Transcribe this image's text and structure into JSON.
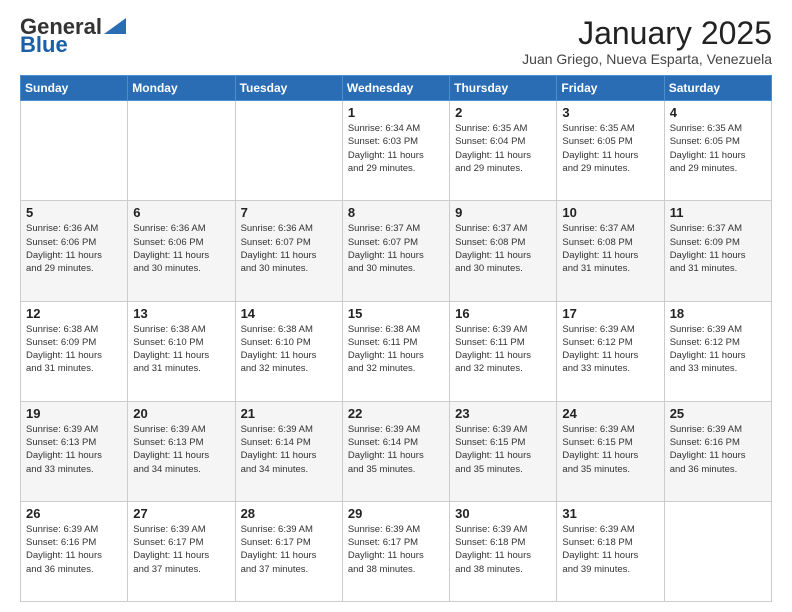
{
  "logo": {
    "general": "General",
    "blue": "Blue"
  },
  "header": {
    "month": "January 2025",
    "location": "Juan Griego, Nueva Esparta, Venezuela"
  },
  "weekdays": [
    "Sunday",
    "Monday",
    "Tuesday",
    "Wednesday",
    "Thursday",
    "Friday",
    "Saturday"
  ],
  "weeks": [
    [
      {
        "day": "",
        "info": ""
      },
      {
        "day": "",
        "info": ""
      },
      {
        "day": "",
        "info": ""
      },
      {
        "day": "1",
        "info": "Sunrise: 6:34 AM\nSunset: 6:03 PM\nDaylight: 11 hours\nand 29 minutes."
      },
      {
        "day": "2",
        "info": "Sunrise: 6:35 AM\nSunset: 6:04 PM\nDaylight: 11 hours\nand 29 minutes."
      },
      {
        "day": "3",
        "info": "Sunrise: 6:35 AM\nSunset: 6:05 PM\nDaylight: 11 hours\nand 29 minutes."
      },
      {
        "day": "4",
        "info": "Sunrise: 6:35 AM\nSunset: 6:05 PM\nDaylight: 11 hours\nand 29 minutes."
      }
    ],
    [
      {
        "day": "5",
        "info": "Sunrise: 6:36 AM\nSunset: 6:06 PM\nDaylight: 11 hours\nand 29 minutes."
      },
      {
        "day": "6",
        "info": "Sunrise: 6:36 AM\nSunset: 6:06 PM\nDaylight: 11 hours\nand 30 minutes."
      },
      {
        "day": "7",
        "info": "Sunrise: 6:36 AM\nSunset: 6:07 PM\nDaylight: 11 hours\nand 30 minutes."
      },
      {
        "day": "8",
        "info": "Sunrise: 6:37 AM\nSunset: 6:07 PM\nDaylight: 11 hours\nand 30 minutes."
      },
      {
        "day": "9",
        "info": "Sunrise: 6:37 AM\nSunset: 6:08 PM\nDaylight: 11 hours\nand 30 minutes."
      },
      {
        "day": "10",
        "info": "Sunrise: 6:37 AM\nSunset: 6:08 PM\nDaylight: 11 hours\nand 31 minutes."
      },
      {
        "day": "11",
        "info": "Sunrise: 6:37 AM\nSunset: 6:09 PM\nDaylight: 11 hours\nand 31 minutes."
      }
    ],
    [
      {
        "day": "12",
        "info": "Sunrise: 6:38 AM\nSunset: 6:09 PM\nDaylight: 11 hours\nand 31 minutes."
      },
      {
        "day": "13",
        "info": "Sunrise: 6:38 AM\nSunset: 6:10 PM\nDaylight: 11 hours\nand 31 minutes."
      },
      {
        "day": "14",
        "info": "Sunrise: 6:38 AM\nSunset: 6:10 PM\nDaylight: 11 hours\nand 32 minutes."
      },
      {
        "day": "15",
        "info": "Sunrise: 6:38 AM\nSunset: 6:11 PM\nDaylight: 11 hours\nand 32 minutes."
      },
      {
        "day": "16",
        "info": "Sunrise: 6:39 AM\nSunset: 6:11 PM\nDaylight: 11 hours\nand 32 minutes."
      },
      {
        "day": "17",
        "info": "Sunrise: 6:39 AM\nSunset: 6:12 PM\nDaylight: 11 hours\nand 33 minutes."
      },
      {
        "day": "18",
        "info": "Sunrise: 6:39 AM\nSunset: 6:12 PM\nDaylight: 11 hours\nand 33 minutes."
      }
    ],
    [
      {
        "day": "19",
        "info": "Sunrise: 6:39 AM\nSunset: 6:13 PM\nDaylight: 11 hours\nand 33 minutes."
      },
      {
        "day": "20",
        "info": "Sunrise: 6:39 AM\nSunset: 6:13 PM\nDaylight: 11 hours\nand 34 minutes."
      },
      {
        "day": "21",
        "info": "Sunrise: 6:39 AM\nSunset: 6:14 PM\nDaylight: 11 hours\nand 34 minutes."
      },
      {
        "day": "22",
        "info": "Sunrise: 6:39 AM\nSunset: 6:14 PM\nDaylight: 11 hours\nand 35 minutes."
      },
      {
        "day": "23",
        "info": "Sunrise: 6:39 AM\nSunset: 6:15 PM\nDaylight: 11 hours\nand 35 minutes."
      },
      {
        "day": "24",
        "info": "Sunrise: 6:39 AM\nSunset: 6:15 PM\nDaylight: 11 hours\nand 35 minutes."
      },
      {
        "day": "25",
        "info": "Sunrise: 6:39 AM\nSunset: 6:16 PM\nDaylight: 11 hours\nand 36 minutes."
      }
    ],
    [
      {
        "day": "26",
        "info": "Sunrise: 6:39 AM\nSunset: 6:16 PM\nDaylight: 11 hours\nand 36 minutes."
      },
      {
        "day": "27",
        "info": "Sunrise: 6:39 AM\nSunset: 6:17 PM\nDaylight: 11 hours\nand 37 minutes."
      },
      {
        "day": "28",
        "info": "Sunrise: 6:39 AM\nSunset: 6:17 PM\nDaylight: 11 hours\nand 37 minutes."
      },
      {
        "day": "29",
        "info": "Sunrise: 6:39 AM\nSunset: 6:17 PM\nDaylight: 11 hours\nand 38 minutes."
      },
      {
        "day": "30",
        "info": "Sunrise: 6:39 AM\nSunset: 6:18 PM\nDaylight: 11 hours\nand 38 minutes."
      },
      {
        "day": "31",
        "info": "Sunrise: 6:39 AM\nSunset: 6:18 PM\nDaylight: 11 hours\nand 39 minutes."
      },
      {
        "day": "",
        "info": ""
      }
    ]
  ]
}
